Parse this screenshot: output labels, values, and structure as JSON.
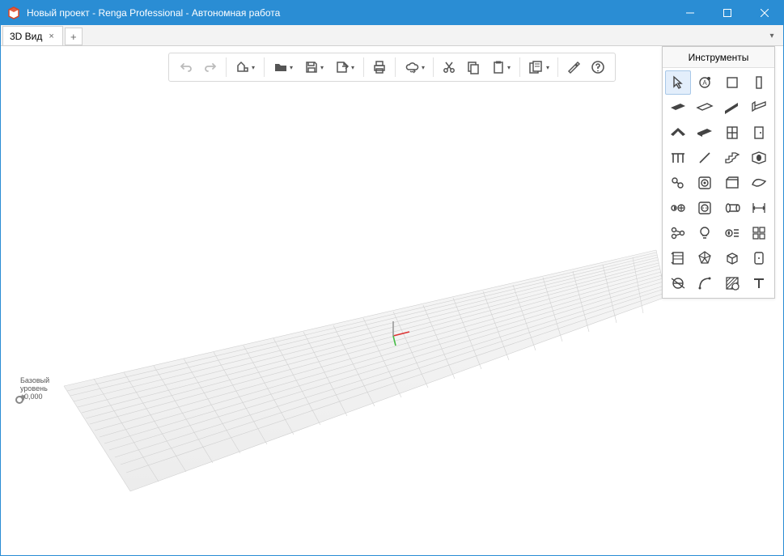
{
  "titlebar": {
    "title": "Новый проект - Renga Professional - Автономная работа"
  },
  "tabs": {
    "active": "3D Вид"
  },
  "toolbar": {
    "undo": "Отменить",
    "redo": "Вернуть",
    "styles": "Стили",
    "open": "Открыть",
    "save": "Сохранить",
    "export": "Экспорт",
    "print": "Печать",
    "cloud": "Синхронизация",
    "cut": "Вырезать",
    "copy": "Копировать",
    "paste": "Вставить",
    "manage": "Управление",
    "settings": "Настройки",
    "help": "Справка"
  },
  "toolspanel": {
    "title": "Инструменты",
    "tools": [
      "select",
      "annotation",
      "wall-section",
      "column",
      "slab-dark",
      "slab-light",
      "ramp",
      "beam",
      "roof",
      "floor",
      "window",
      "door",
      "railing",
      "line-object",
      "stair",
      "opening",
      "pipe-fitting",
      "equipment-round",
      "component",
      "duct",
      "sanitary",
      "socket",
      "axis",
      "dimension",
      "connector",
      "lamp",
      "fire",
      "array",
      "section",
      "polyhedron",
      "wireframe",
      "panel",
      "level",
      "arc",
      "hatch",
      "text"
    ]
  },
  "level": {
    "name": "Базовый",
    "sub": "уровень",
    "elevation": "±0,000"
  }
}
